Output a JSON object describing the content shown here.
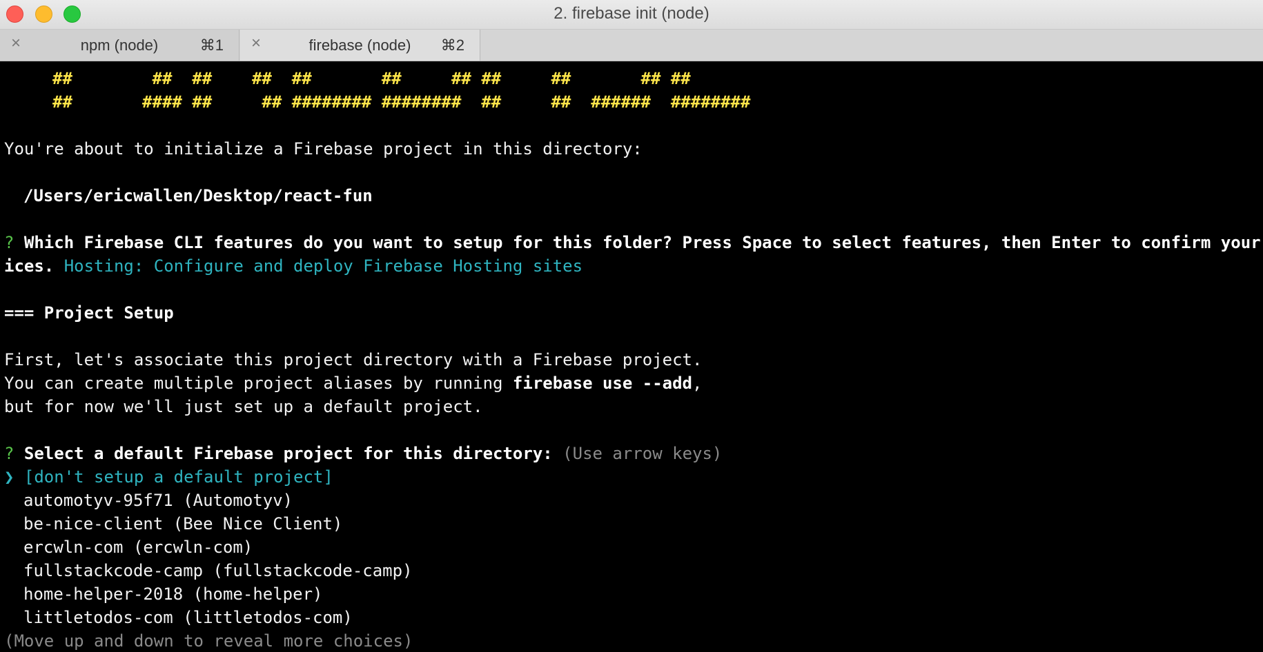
{
  "window": {
    "title": "2. firebase init (node)"
  },
  "tabs": [
    {
      "label": "npm (node)",
      "shortcut": "⌘1",
      "close_icon": "×"
    },
    {
      "label": "firebase (node)",
      "shortcut": "⌘2",
      "close_icon": "×"
    }
  ],
  "terminal": {
    "ascii_line1": "##        ##  ##    ##  ##       ##     ## ##     ##       ## ##",
    "ascii_line2": "##       #### ##     ## ######## ########  ##     ##  ######  ########",
    "intro": "You're about to initialize a Firebase project in this directory:",
    "path": "/Users/ericwallen/Desktop/react-fun",
    "q1_mark": "?",
    "q1_text": "Which Firebase CLI features do you want to setup for this folder? Press Space to select features, then Enter to confirm your cho",
    "q1_cont": "ices.",
    "q1_answer": "Hosting: Configure and deploy Firebase Hosting sites",
    "section": "=== Project Setup",
    "para1": "First, let's associate this project directory with a Firebase project.",
    "para2_pre": "You can create multiple project aliases by running ",
    "para2_cmd": "firebase use --add",
    "para2_post": ",",
    "para3": "but for now we'll just set up a default project.",
    "q2_mark": "?",
    "q2_text": "Select a default Firebase project for this directory:",
    "q2_hint": "(Use arrow keys)",
    "pointer": "❯",
    "options": [
      "[don't setup a default project]",
      "automotyv-95f71 (Automotyv)",
      "be-nice-client (Bee Nice Client)",
      "ercwln-com (ercwln-com)",
      "fullstackcode-camp (fullstackcode-camp)",
      "home-helper-2018 (home-helper)",
      "littletodos-com (littletodos-com)"
    ],
    "more_hint": "(Move up and down to reveal more choices)"
  },
  "colors": {
    "background": "#000000",
    "ascii": "#fde54a",
    "accent_cyan": "#2fb4c0",
    "prompt_green": "#58c34a",
    "hint_gray": "#8a8a8a"
  }
}
